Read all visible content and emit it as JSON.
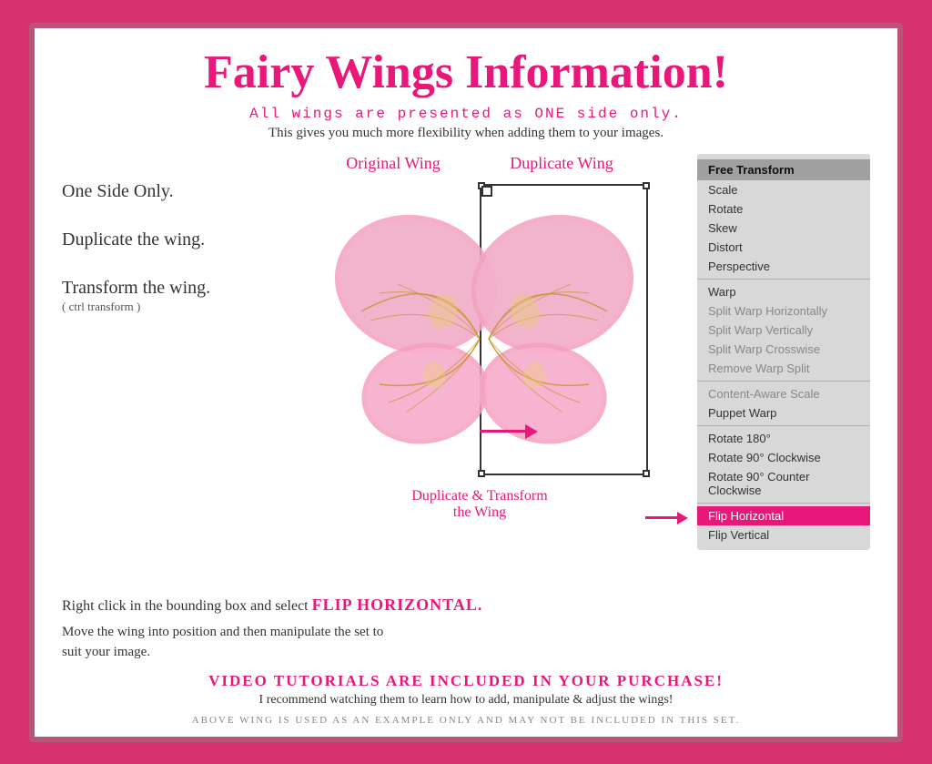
{
  "page": {
    "title": "Fairy Wings Information!",
    "subtitle_main": "All wings are presented as ONE side only.",
    "subtitle_sub": "This gives you much more flexibility when adding them to your images.",
    "left_labels": [
      {
        "id": "one-side",
        "text": "One Side Only."
      },
      {
        "id": "duplicate",
        "text": "Duplicate the wing."
      },
      {
        "id": "transform",
        "text": "Transform the wing.\n( ctrl transform )"
      }
    ],
    "wing_labels": {
      "original": "Original Wing",
      "duplicate": "Duplicate Wing"
    },
    "duplicate_transform_label": "Duplicate & Transform\nthe Wing",
    "right_click_text": "Right click in the bounding box and select",
    "flip_horizontal": "FLIP HORIZONTAL.",
    "move_text": "Move the wing into position and then manipulate the set to\nsuit your image.",
    "video_text": "VIDEO TUTORIALS ARE INCLUDED IN YOUR PURCHASE!",
    "video_sub": "I recommend watching them to learn how to add, manipulate & adjust the wings!",
    "footer": "ABOVE WING IS USED AS AN EXAMPLE ONLY AND MAY NOT BE INCLUDED IN THIS SET.",
    "menu": {
      "items": [
        {
          "id": "free-transform",
          "label": "Free Transform",
          "type": "header"
        },
        {
          "id": "scale",
          "label": "Scale",
          "type": "item"
        },
        {
          "id": "rotate",
          "label": "Rotate",
          "type": "item"
        },
        {
          "id": "skew",
          "label": "Skew",
          "type": "item"
        },
        {
          "id": "distort",
          "label": "Distort",
          "type": "item"
        },
        {
          "id": "perspective",
          "label": "Perspective",
          "type": "item"
        },
        {
          "id": "sep1",
          "type": "separator"
        },
        {
          "id": "warp",
          "label": "Warp",
          "type": "item"
        },
        {
          "id": "split-warp-h",
          "label": "Split Warp Horizontally",
          "type": "item-disabled"
        },
        {
          "id": "split-warp-v",
          "label": "Split Warp Vertically",
          "type": "item-disabled"
        },
        {
          "id": "split-warp-c",
          "label": "Split Warp Crosswise",
          "type": "item-disabled"
        },
        {
          "id": "remove-warp",
          "label": "Remove Warp Split",
          "type": "item-disabled"
        },
        {
          "id": "sep2",
          "type": "separator"
        },
        {
          "id": "content-aware",
          "label": "Content-Aware Scale",
          "type": "item-disabled"
        },
        {
          "id": "puppet-warp",
          "label": "Puppet Warp",
          "type": "item"
        },
        {
          "id": "sep3",
          "type": "separator"
        },
        {
          "id": "rotate180",
          "label": "Rotate 180°",
          "type": "item"
        },
        {
          "id": "rotate90cw",
          "label": "Rotate 90° Clockwise",
          "type": "item"
        },
        {
          "id": "rotate90ccw",
          "label": "Rotate 90° Counter Clockwise",
          "type": "item"
        },
        {
          "id": "sep4",
          "type": "separator"
        },
        {
          "id": "flip-h",
          "label": "Flip Horizontal",
          "type": "highlighted"
        },
        {
          "id": "flip-v",
          "label": "Flip Vertical",
          "type": "item"
        }
      ]
    }
  }
}
